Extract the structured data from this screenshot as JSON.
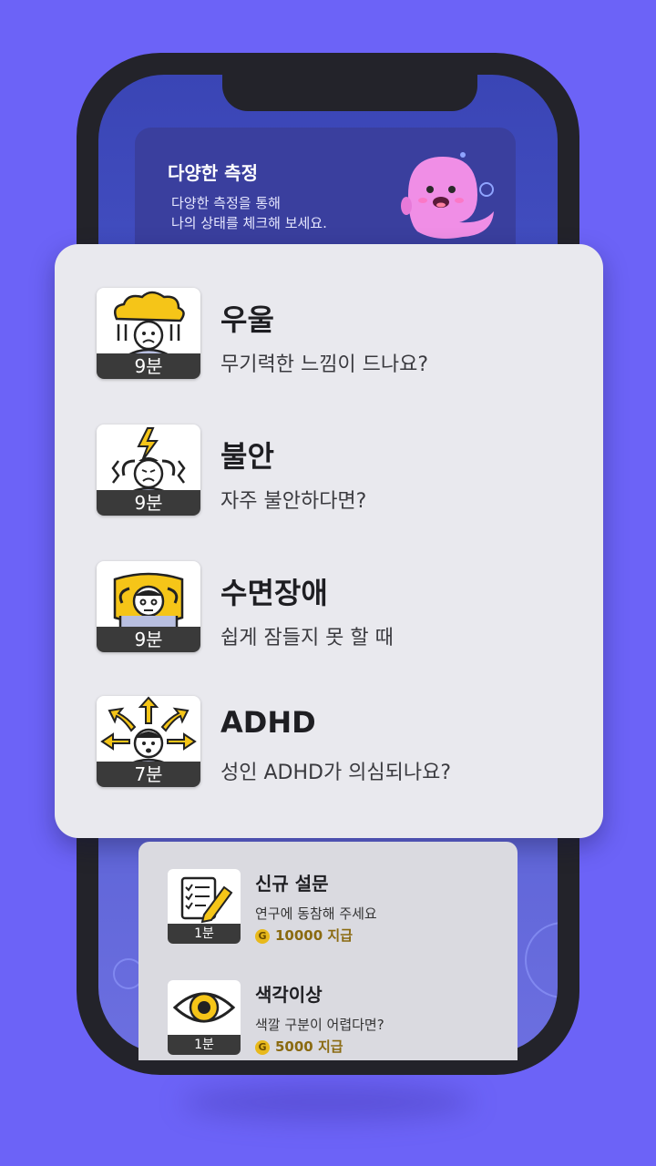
{
  "banner": {
    "title": "다양한 측정",
    "description": "다양한 측정을 통해\n나의 상태를 체크해 보세요."
  },
  "tests": [
    {
      "title": "우울",
      "description": "무기력한 느낌이 드나요?",
      "duration": "9분",
      "icon": "depression-icon"
    },
    {
      "title": "불안",
      "description": "자주 불안하다면?",
      "duration": "9분",
      "icon": "anxiety-icon"
    },
    {
      "title": "수면장애",
      "description": "쉽게 잠들지 못 할 때",
      "duration": "9분",
      "icon": "sleep-icon"
    },
    {
      "title": "ADHD",
      "description": "성인 ADHD가 의심되나요?",
      "duration": "7분",
      "icon": "adhd-icon"
    }
  ],
  "extra_tests": [
    {
      "title": "신규 설문",
      "description": "연구에 동참해 주세요",
      "duration": "1분",
      "reward": "10000 지급",
      "coin": "G",
      "icon": "survey-icon"
    },
    {
      "title": "색각이상",
      "description": "색깔 구분이 어렵다면?",
      "duration": "1분",
      "reward": "5000 지급",
      "coin": "G",
      "icon": "eye-icon"
    }
  ],
  "colors": {
    "background": "#6c63f7",
    "accent_yellow": "#f5c518",
    "card": "#e9e9ee"
  }
}
